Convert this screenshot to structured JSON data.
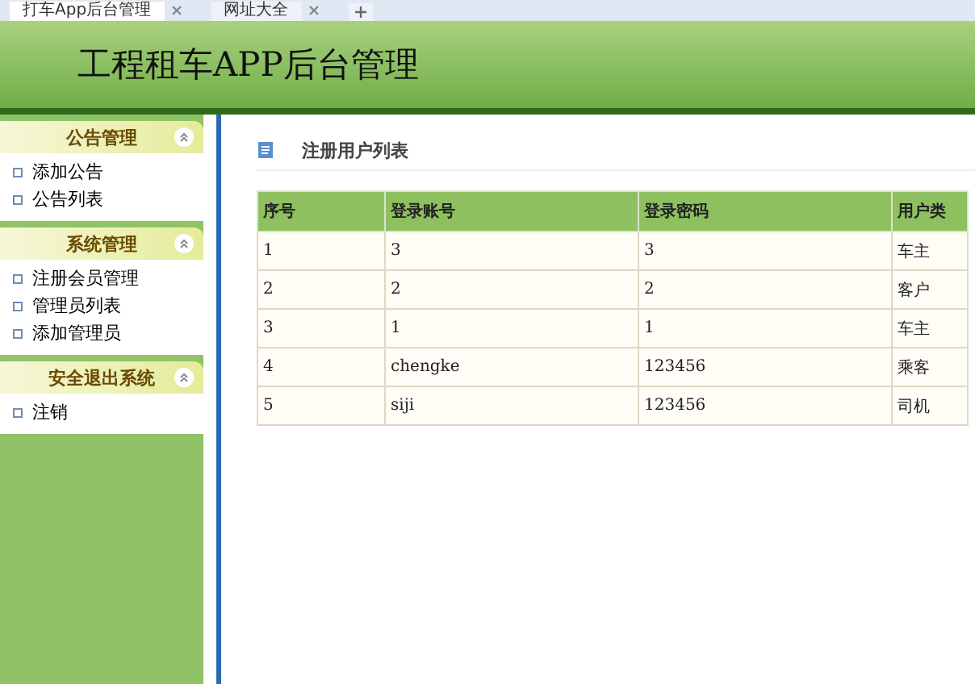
{
  "browser_tabs": [
    {
      "title": "打车App后台管理",
      "selected": true
    },
    {
      "title": "网址大全",
      "selected": false
    }
  ],
  "header": {
    "title": "工程租车APP后台管理"
  },
  "sidebar": {
    "groups": [
      {
        "title": "公告管理",
        "expanded": true,
        "items": [
          "添加公告",
          "公告列表"
        ]
      },
      {
        "title": "系统管理",
        "expanded": true,
        "items": [
          "注册会员管理",
          "管理员列表",
          "添加管理员"
        ]
      },
      {
        "title": "安全退出系统",
        "expanded": true,
        "items": [
          "注销"
        ]
      }
    ]
  },
  "content": {
    "title": "注册用户列表",
    "table": {
      "columns": [
        "序号",
        "登录账号",
        "登录密码",
        "用户类"
      ],
      "rows": [
        [
          "1",
          "3",
          "3",
          "车主"
        ],
        [
          "2",
          "2",
          "2",
          "客户"
        ],
        [
          "3",
          "1",
          "1",
          "车主"
        ],
        [
          "4",
          "chengke",
          "123456",
          "乘客"
        ],
        [
          "5",
          "siji",
          "123456",
          "司机"
        ]
      ]
    }
  }
}
